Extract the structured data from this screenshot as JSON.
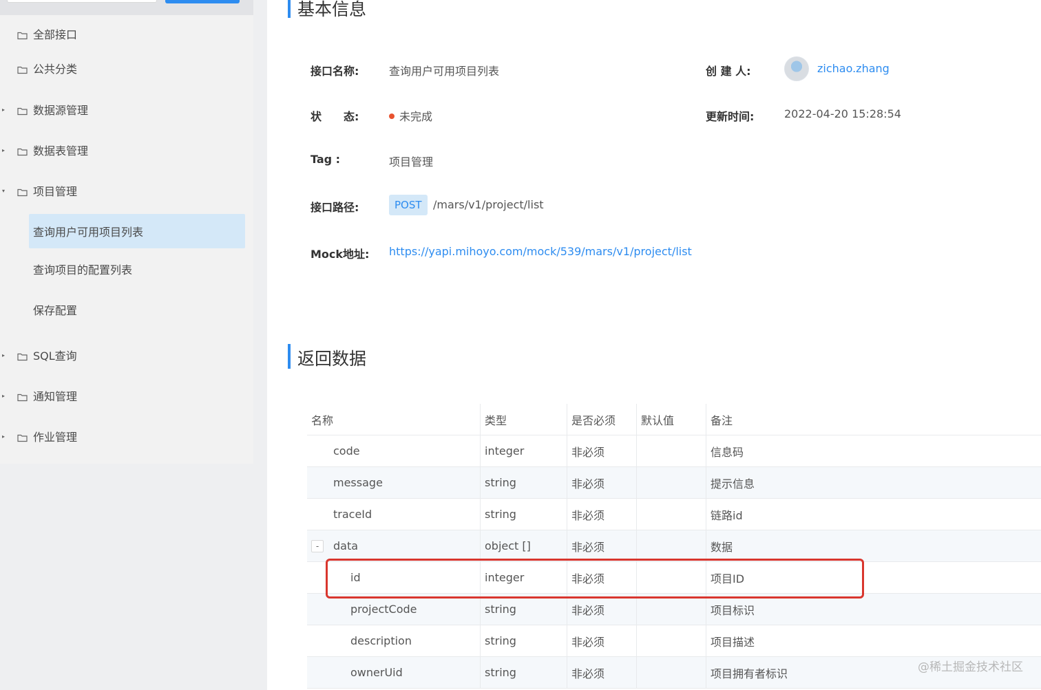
{
  "sidebar": {
    "items": [
      {
        "label": "全部接口",
        "caret": ""
      },
      {
        "label": "公共分类",
        "caret": ""
      },
      {
        "label": "数据源管理",
        "caret": "▸"
      },
      {
        "label": "数据表管理",
        "caret": "▸"
      },
      {
        "label": "项目管理",
        "caret": "▾"
      },
      {
        "label": "SQL查询",
        "caret": "▸"
      },
      {
        "label": "通知管理",
        "caret": "▸"
      },
      {
        "label": "作业管理",
        "caret": "▸"
      }
    ],
    "sub_items": [
      {
        "label": "查询用户可用项目列表",
        "active": true
      },
      {
        "label": "查询项目的配置列表",
        "active": false
      },
      {
        "label": "保存配置",
        "active": false
      }
    ]
  },
  "basic": {
    "title": "基本信息",
    "name_label": "接口名称:",
    "name_value": "查询用户可用项目列表",
    "creator_label": "创 建 人:",
    "creator_value": "zichao.zhang",
    "status_label": "状　　态:",
    "status_value": "未完成",
    "status_color": "#e8522f",
    "updated_label": "更新时间:",
    "updated_value": "2022-04-20 15:28:54",
    "tag_label": "Tag :",
    "tag_value": "项目管理",
    "path_label": "接口路径:",
    "method": "POST",
    "path_value": "/mars/v1/project/list",
    "mock_label": "Mock地址:",
    "mock_value": "https://yapi.mihoyo.com/mock/539/mars/v1/project/list"
  },
  "response": {
    "title": "返回数据",
    "headers": [
      "名称",
      "类型",
      "是否必须",
      "默认值",
      "备注"
    ],
    "rows": [
      {
        "name": "code",
        "type": "integer",
        "required": "非必须",
        "default": "",
        "note": "信息码",
        "level": 0
      },
      {
        "name": "message",
        "type": "string",
        "required": "非必须",
        "default": "",
        "note": "提示信息",
        "level": 0
      },
      {
        "name": "traceId",
        "type": "string",
        "required": "非必须",
        "default": "",
        "note": "链路id",
        "level": 0
      },
      {
        "name": "data",
        "type": "object []",
        "required": "非必须",
        "default": "",
        "note": "数据",
        "level": 0,
        "expander": "-"
      },
      {
        "name": "id",
        "type": "integer",
        "required": "非必须",
        "default": "",
        "note": "项目ID",
        "level": 1
      },
      {
        "name": "projectCode",
        "type": "string",
        "required": "非必须",
        "default": "",
        "note": "项目标识",
        "level": 1
      },
      {
        "name": "description",
        "type": "string",
        "required": "非必须",
        "default": "",
        "note": "项目描述",
        "level": 1
      },
      {
        "name": "ownerUid",
        "type": "string",
        "required": "非必须",
        "default": "",
        "note": "项目拥有者标识",
        "level": 1
      }
    ]
  },
  "watermark": "@稀土掘金技术社区",
  "colors": {
    "accent": "#2d8cf0",
    "highlight": "#d9362e"
  }
}
